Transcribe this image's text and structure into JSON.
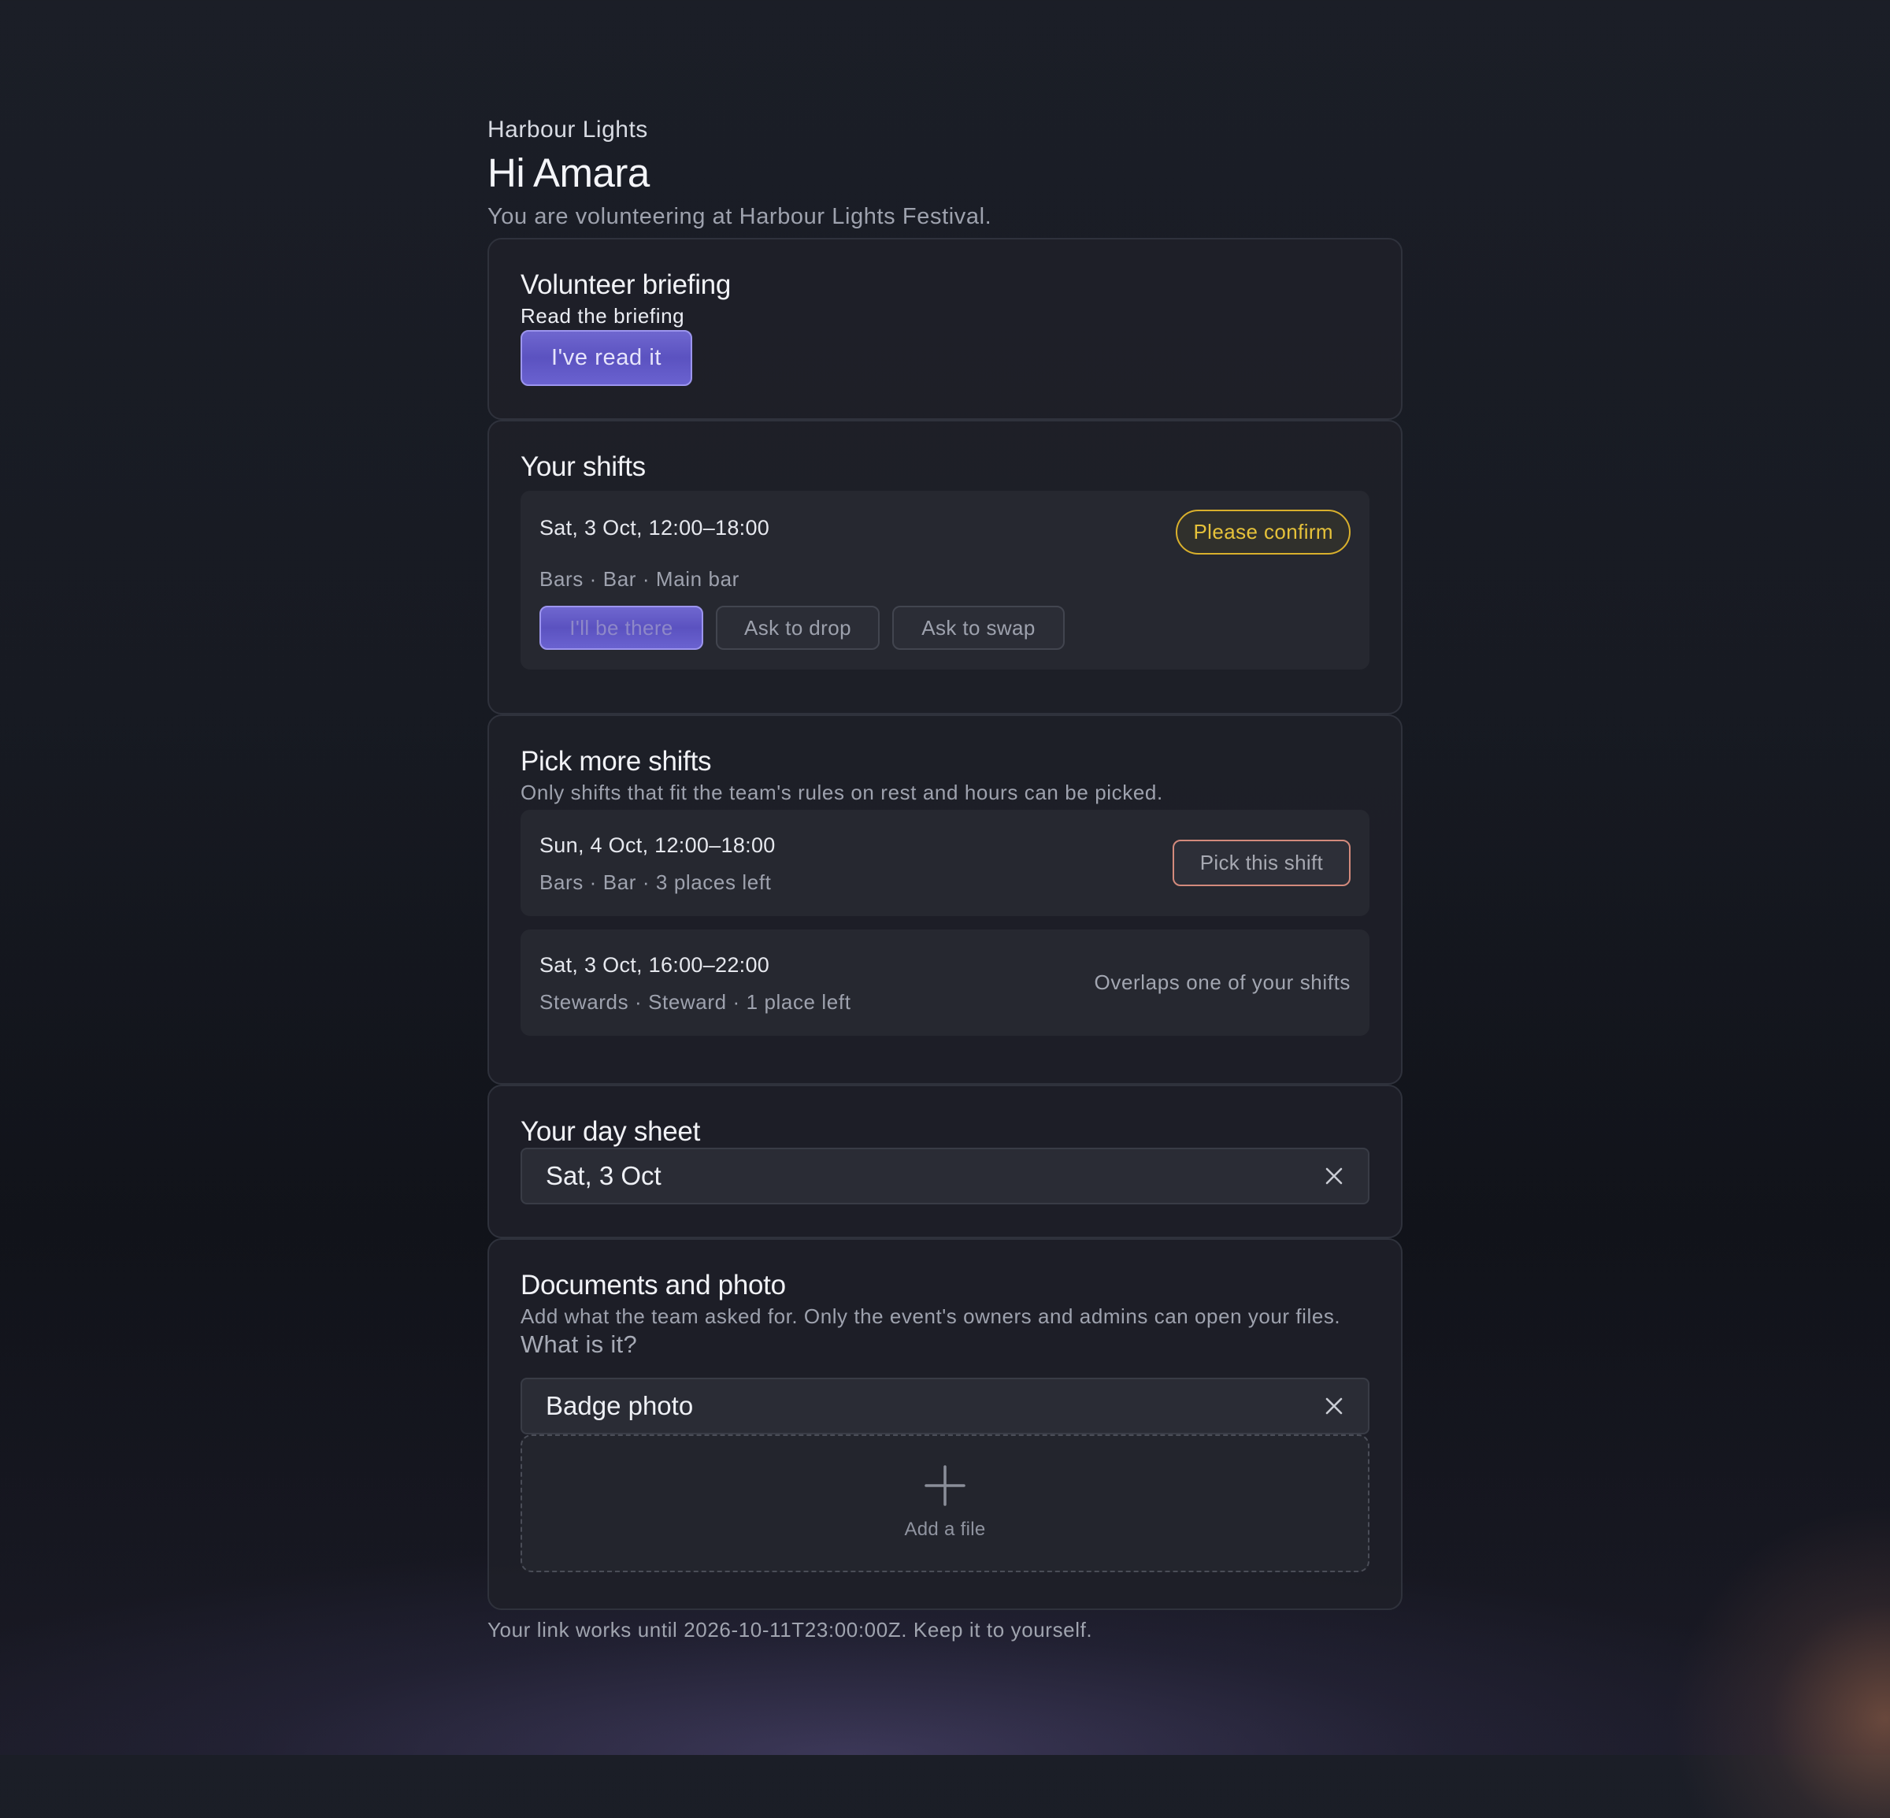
{
  "header": {
    "org": "Harbour Lights",
    "greeting": "Hi Amara",
    "subtitle": "You are volunteering at Harbour Lights Festival."
  },
  "briefing": {
    "title": "Volunteer briefing",
    "link": "Read the briefing",
    "button": "I've read it"
  },
  "shifts": {
    "title": "Your shifts",
    "items": [
      {
        "date": "Sat, 3 Oct, 12:00–18:00",
        "status": "Please confirm",
        "meta": "Bars · Bar · Main bar",
        "actions": [
          "I'll be there",
          "Ask to drop",
          "Ask to swap"
        ]
      }
    ]
  },
  "pick": {
    "title": "Pick more shifts",
    "hint": "Only shifts that fit the team's rules on rest and hours can be picked.",
    "items": [
      {
        "date": "Sun, 4 Oct, 12:00–18:00",
        "meta": "Bars · Bar · 3 places left",
        "action": "Pick this shift"
      },
      {
        "date": "Sat, 3 Oct, 16:00–22:00",
        "meta": "Stewards · Steward · 1 place left",
        "note": "Overlaps one of your shifts"
      }
    ]
  },
  "day_sheet": {
    "title": "Your day sheet",
    "selected": "Sat, 3 Oct"
  },
  "documents": {
    "title": "Documents and photo",
    "hint": "Add what the team asked for. Only the event's owners and admins can open your files.",
    "question": "What is it?",
    "selected": "Badge photo",
    "add_label": "Add a file"
  },
  "footer": "Your link works until 2026-10-11T23:00:00Z. Keep it to yourself.",
  "colors": {
    "accent": "#6f67cf",
    "warning": "#d9b02c",
    "pick_border": "#d38a7c"
  },
  "icons": {
    "clear": "close-icon",
    "add": "plus-icon"
  }
}
